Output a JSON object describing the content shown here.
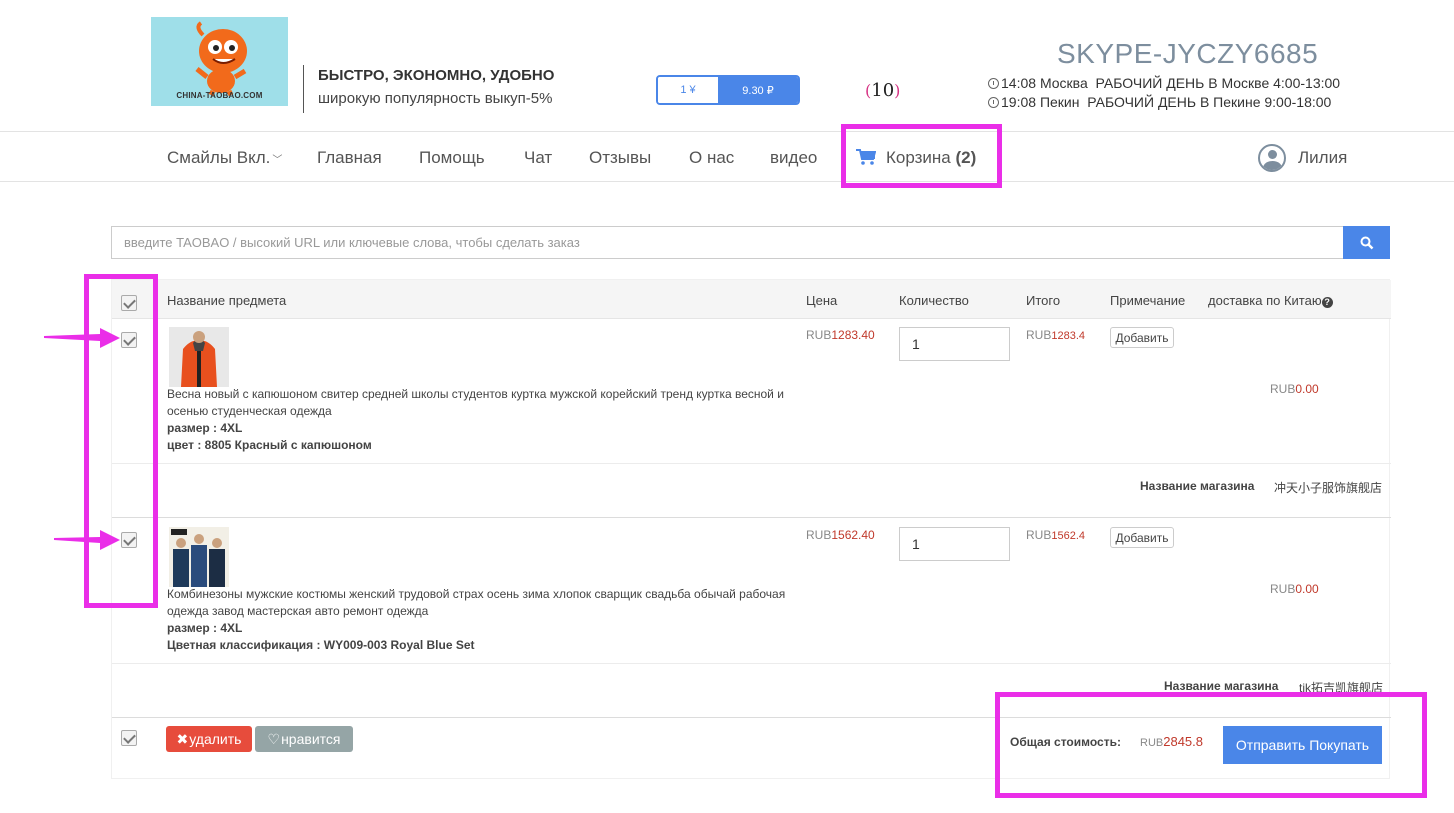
{
  "header": {
    "logo_text": "CHINA-TAOBAO.COM",
    "tagline_bold": "БЫСТРО, ЭКОНОМНО, УДОБНО",
    "tagline": "широкую популярность выкуп-5%",
    "rate_left": "1 ¥",
    "rate_right": "9.30 ₽",
    "counter": "10",
    "skype": "SKYPE-JYCZY6685",
    "times": [
      {
        "time": "14:08",
        "city": "Москва",
        "hours": "РАБОЧИЙ ДЕНЬ В Москве 4:00-13:00"
      },
      {
        "time": "19:08",
        "city": "Пекин",
        "hours": "РАБОЧИЙ ДЕНЬ В Пекине 9:00-18:00"
      }
    ]
  },
  "nav": {
    "items": [
      "Смайлы Вкл.",
      "Главная",
      "Помощь",
      "Чат",
      "Отзывы",
      "О нас",
      "видео"
    ],
    "cart_label": "Корзина",
    "cart_count": "(2)",
    "user": "Лилия"
  },
  "search": {
    "placeholder": "введите TAOBAO / высокий URL или ключевые слова, чтобы сделать заказ"
  },
  "table": {
    "headers": [
      "Название предмета",
      "Цена",
      "Количество",
      "Итого",
      "Примечание",
      "доставка по Китаю"
    ],
    "currency": "RUB",
    "add_label": "Добавить",
    "store_label": "Название магазина",
    "items": [
      {
        "description": "Весна новый с капюшоном свитер средней школы студентов куртка мужской корейский тренд куртка весной и осенью студенческая одежда",
        "attr1": "размер : 4XL",
        "attr2": "цвет : 8805 Красный с капюшоном",
        "price": "1283.40",
        "qty": "1",
        "total": "1283.4",
        "shipping": "0.00",
        "store": "冲天小子服饰旗舰店"
      },
      {
        "description": "Комбинезоны мужские костюмы женский трудовой страх осень зима хлопок сварщик свадьба обычай рабочая одежда завод мастерская авто ремонт одежда",
        "attr1": "размер : 4XL",
        "attr2": "Цветная классификация : WY009-003 Royal Blue Set",
        "price": "1562.40",
        "qty": "1",
        "total": "1562.4",
        "shipping": "0.00",
        "store": "tjk拓吉凯旗舰店"
      }
    ]
  },
  "footer": {
    "delete_label": "удалить",
    "like_label": "нравится",
    "total_label": "Общая стоимость:",
    "total_currency": "RUB",
    "total_value": "2845.8",
    "submit_label": "Отправить Покупать"
  },
  "colors": {
    "accent": "#4a86e8",
    "danger": "#e74c3c",
    "price": "#c0392b",
    "annotation": "#ea2ee8"
  }
}
